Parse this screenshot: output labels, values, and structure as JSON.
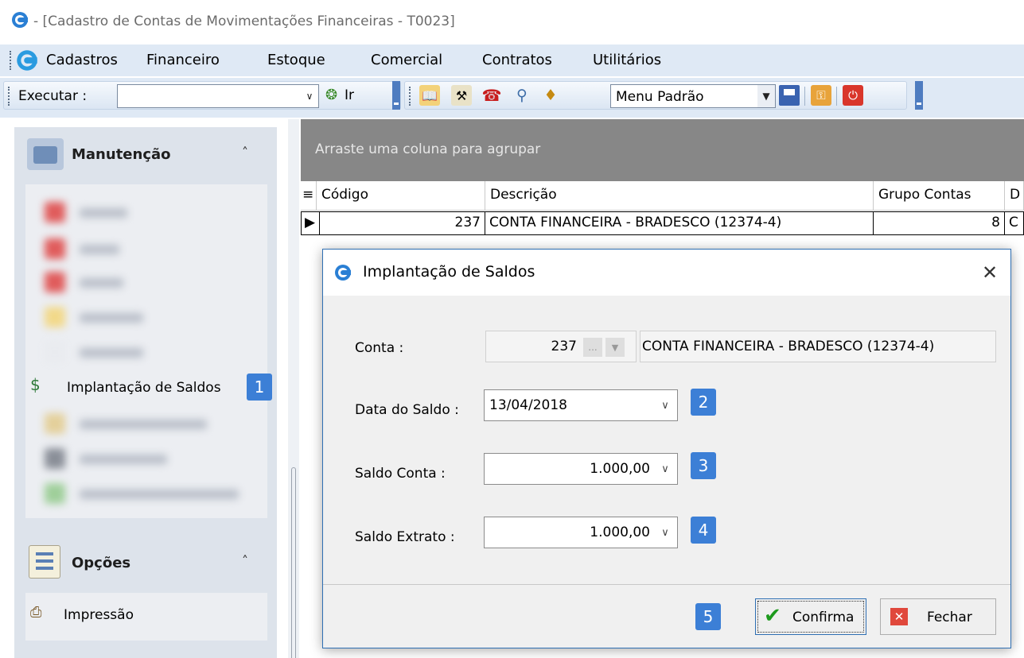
{
  "window": {
    "title": "- [Cadastro de Contas de Movimentações Financeiras - T0023]"
  },
  "menubar": {
    "items": [
      {
        "label": "Cadastros"
      },
      {
        "label": "Financeiro"
      },
      {
        "label": "Estoque"
      },
      {
        "label": "Comercial"
      },
      {
        "label": "Contratos"
      },
      {
        "label": "Utilitários"
      }
    ]
  },
  "toolbar": {
    "execute_label": "Executar :",
    "execute_value": "",
    "go_label": "Ir",
    "menu_select_value": "Menu Padrão"
  },
  "sidebar": {
    "maintenance_title": "Manutenção",
    "active_item_label": "Implantação de Saldos",
    "active_item_badge": "1",
    "options_title": "Opções",
    "options_items": [
      {
        "label": "Impressão"
      }
    ]
  },
  "grid": {
    "group_hint": "Arraste uma coluna para agrupar",
    "columns": [
      "Código",
      "Descrição",
      "Grupo Contas",
      "D"
    ],
    "rows": [
      {
        "codigo": "237",
        "descricao": "CONTA FINANCEIRA - BRADESCO (12374-4)",
        "grupo": "8",
        "extra": "C"
      }
    ]
  },
  "dialog": {
    "title": "Implantação de Saldos",
    "conta_label": "Conta :",
    "conta_code": "237",
    "conta_ellipsis": "...",
    "conta_description": "CONTA FINANCEIRA - BRADESCO (12374-4)",
    "data_label": "Data do Saldo :",
    "data_value": "13/04/2018",
    "data_badge": "2",
    "saldo_conta_label": "Saldo Conta :",
    "saldo_conta_value": "1.000,00",
    "saldo_conta_badge": "3",
    "saldo_extrato_label": "Saldo Extrato :",
    "saldo_extrato_value": "1.000,00",
    "saldo_extrato_badge": "4",
    "confirm_badge": "5",
    "confirm_label": "Confirma",
    "close_label": "Fechar"
  },
  "colors": {
    "badge": "#3c7fd6",
    "accent": "#2f6fb3",
    "group_band": "#878787"
  }
}
